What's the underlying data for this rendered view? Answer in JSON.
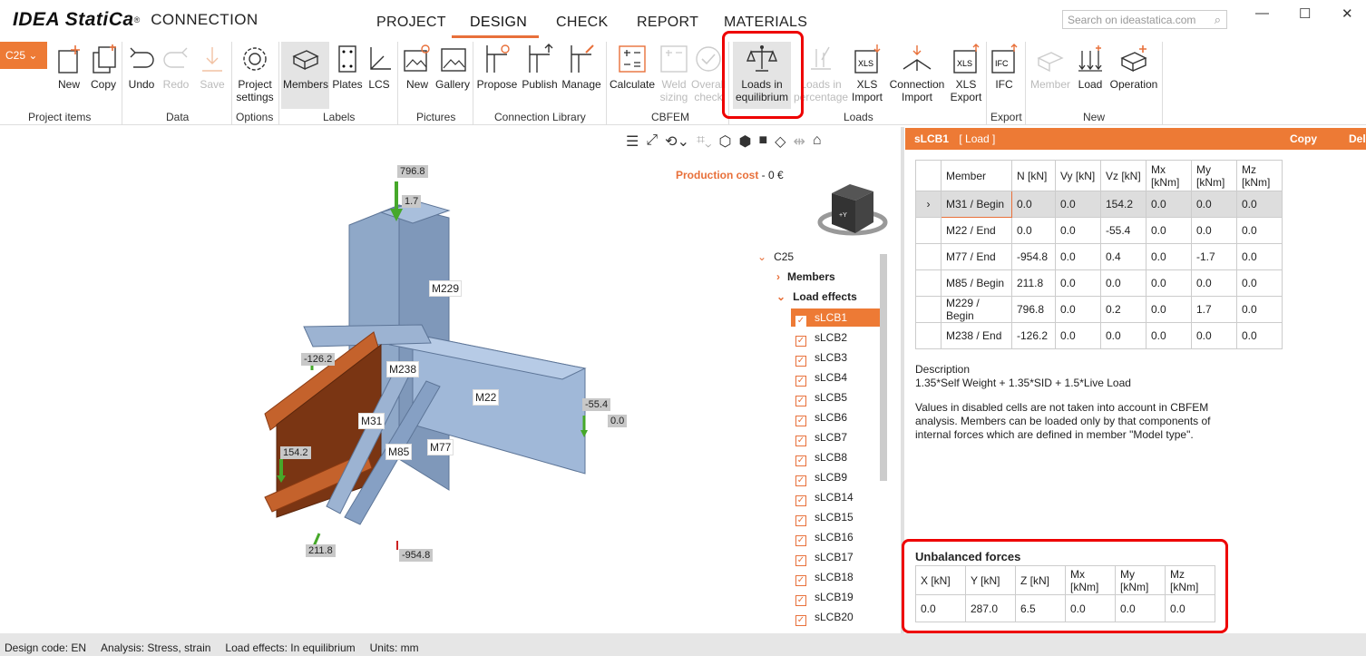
{
  "app": {
    "brand": "IDEA StatiCa",
    "registered": "®",
    "product": "CONNECTION"
  },
  "nav": {
    "items": [
      "PROJECT",
      "DESIGN",
      "CHECK",
      "REPORT",
      "MATERIALS"
    ],
    "active": "DESIGN"
  },
  "search": {
    "placeholder": "Search on ideastatica.com"
  },
  "window": {
    "min": "—",
    "max": "☐",
    "close": "✕"
  },
  "ribbon": {
    "project_select": "C25",
    "groups": [
      "Project items",
      "Data",
      "Options",
      "Labels",
      "Pictures",
      "Connection Library",
      "CBFEM",
      "Loads",
      "Export",
      "New"
    ],
    "buttons": {
      "new": "New",
      "copy": "Copy",
      "undo": "Undo",
      "redo": "Redo",
      "save": "Save",
      "project_settings": "Project settings",
      "members": "Members",
      "plates": "Plates",
      "lcs": "LCS",
      "pic_new": "New",
      "gallery": "Gallery",
      "propose": "Propose",
      "publish": "Publish",
      "manage": "Manage",
      "calculate": "Calculate",
      "weld_sizing": "Weld sizing",
      "overall_check": "Overall check",
      "loads_in_equilibrium": "Loads in equilibrium",
      "loads_percentage": "Loads in percentage",
      "xls_import": "XLS Import",
      "connection_import": "Connection Import",
      "xls_export": "XLS Export",
      "ifc": "IFC",
      "member_new": "Member",
      "load_new": "Load",
      "operation_new": "Operation"
    }
  },
  "viewport": {
    "production_cost_label": "Production cost",
    "production_cost_value": " - 0 €",
    "members": [
      "M229",
      "M238",
      "M22",
      "M31",
      "M85",
      "M77"
    ],
    "force_labels": [
      "796.8",
      "1.7",
      "-126.2",
      "-55.4",
      "0.0",
      "154.2",
      "211.8",
      "-954.8"
    ]
  },
  "tree": {
    "root": "C25",
    "members": "Members",
    "load_effects": "Load effects",
    "cases": [
      "sLCB1",
      "sLCB2",
      "sLCB3",
      "sLCB4",
      "sLCB5",
      "sLCB6",
      "sLCB7",
      "sLCB8",
      "sLCB9",
      "sLCB14",
      "sLCB15",
      "sLCB16",
      "sLCB17",
      "sLCB18",
      "sLCB19",
      "sLCB20"
    ],
    "selected": "sLCB1"
  },
  "load_panel": {
    "title": "sLCB1",
    "tag": "[ Load ]",
    "copy": "Copy",
    "delete": "Delete",
    "columns": [
      "Member",
      "N [kN]",
      "Vy [kN]",
      "Vz [kN]",
      "Mx [kNm]",
      "My [kNm]",
      "Mz [kNm]"
    ],
    "rows": [
      [
        "M31 / Begin",
        "0.0",
        "0.0",
        "154.2",
        "0.0",
        "0.0",
        "0.0"
      ],
      [
        "M22 / End",
        "0.0",
        "0.0",
        "-55.4",
        "0.0",
        "0.0",
        "0.0"
      ],
      [
        "M77 / End",
        "-954.8",
        "0.0",
        "0.4",
        "0.0",
        "-1.7",
        "0.0"
      ],
      [
        "M85 / Begin",
        "211.8",
        "0.0",
        "0.0",
        "0.0",
        "0.0",
        "0.0"
      ],
      [
        "M229 / Begin",
        "796.8",
        "0.0",
        "0.2",
        "0.0",
        "1.7",
        "0.0"
      ],
      [
        "M238 / End",
        "-126.2",
        "0.0",
        "0.0",
        "0.0",
        "0.0",
        "0.0"
      ]
    ],
    "description_label": "Description",
    "description": "1.35*Self Weight + 1.35*SID + 1.5*Live Load",
    "note": "Values in disabled cells are not taken into account in CBFEM analysis. Members can be loaded only by that components of internal forces which are defined in member \"Model type\".",
    "unbalanced_title": "Unbalanced forces",
    "unbalanced_columns": [
      "X [kN]",
      "Y [kN]",
      "Z [kN]",
      "Mx [kNm]",
      "My [kNm]",
      "Mz [kNm]"
    ],
    "unbalanced_values": [
      "0.0",
      "287.0",
      "6.5",
      "0.0",
      "0.0",
      "0.0"
    ]
  },
  "status": {
    "design_code": "Design code: EN",
    "analysis": "Analysis: Stress, strain",
    "load_effects": "Load effects: In equilibrium",
    "units": "Units: mm"
  },
  "colors": {
    "accent": "#ed7a35",
    "highlight": "#e00000",
    "steel": "#8fa8c8",
    "plate": "#c4622c"
  }
}
